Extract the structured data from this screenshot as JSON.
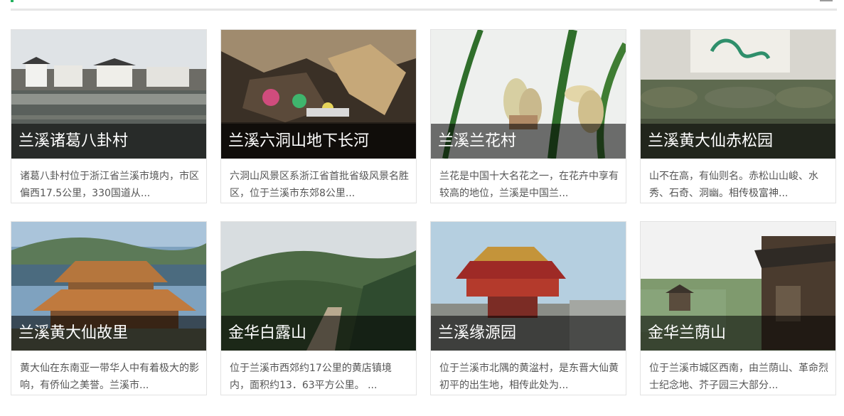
{
  "cards": [
    {
      "title": "兰溪诸葛八卦村",
      "desc": "诸葛八卦村位于浙江省兰溪市境内，市区偏西17.5公里，330国道从..."
    },
    {
      "title": "兰溪六洞山地下长河",
      "desc": "六洞山风景区系浙江省首批省级风景名胜区，位于兰溪市东郊8公里..."
    },
    {
      "title": "兰溪兰花村",
      "desc": "兰花是中国十大名花之一，在花卉中享有较高的地位，兰溪是中国兰..."
    },
    {
      "title": "兰溪黄大仙赤松园",
      "desc": "山不在高，有仙则名。赤松山山峻、水秀、石奇、洞幽。相传极富神..."
    },
    {
      "title": "兰溪黄大仙故里",
      "desc": "黄大仙在东南亚一带华人中有着极大的影响，有侨仙之美誉。兰溪市..."
    },
    {
      "title": "金华白露山",
      "desc": "位于兰溪市西郊约17公里的黄店镇境内，面积约13．63平方公里。 ..."
    },
    {
      "title": "兰溪缘源园",
      "desc": "位于兰溪市北隅的黄湓村，是东晋大仙黄初平的出生地，相传此处为..."
    },
    {
      "title": "金华兰荫山",
      "desc": "位于兰溪市城区西南，由兰荫山、革命烈士纪念地、芥子园三大部分..."
    }
  ]
}
